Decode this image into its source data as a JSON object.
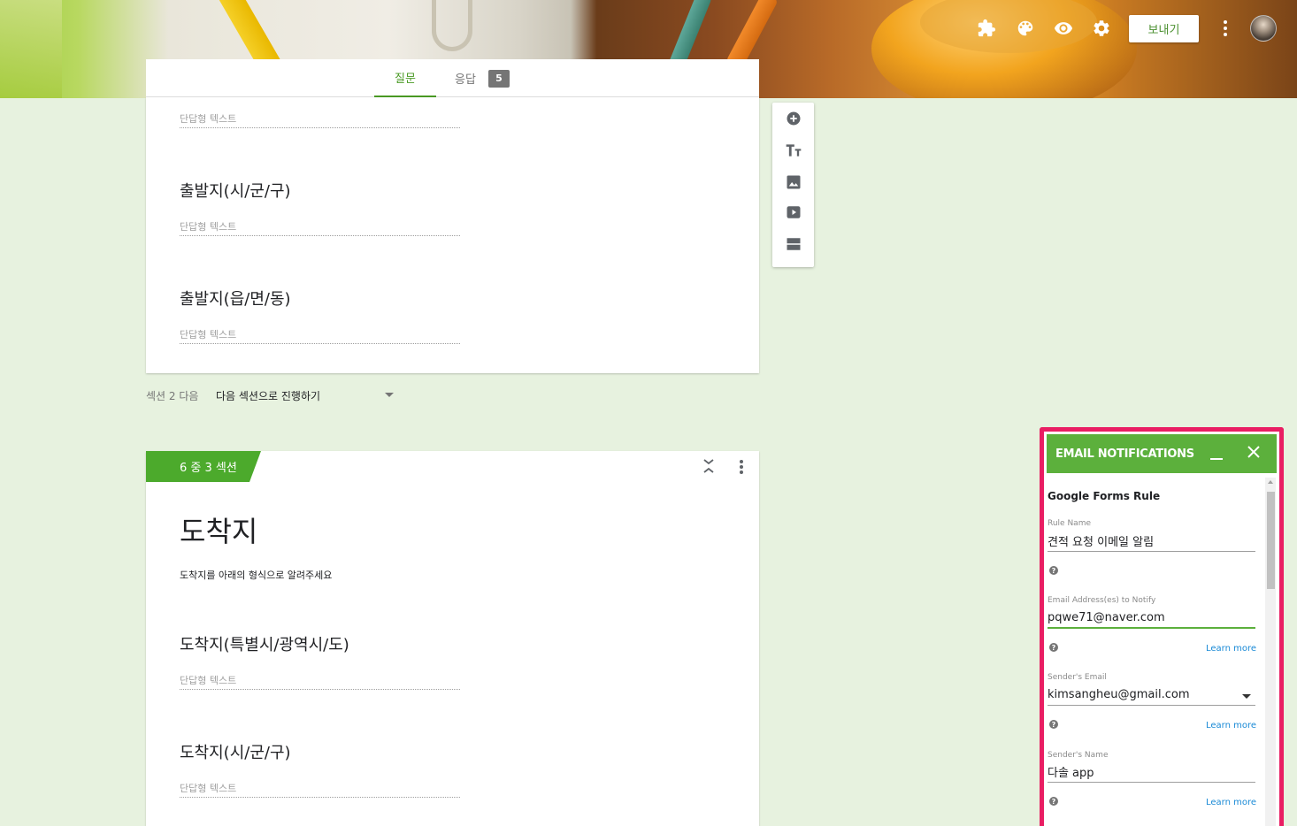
{
  "header": {
    "send_label": "보내기",
    "icons": [
      "puzzle-icon",
      "palette-icon",
      "eye-icon",
      "gear-icon",
      "more-vert-icon"
    ]
  },
  "tabs": {
    "questions": "질문",
    "responses": "응답",
    "responses_count": "5"
  },
  "section2": {
    "questions": [
      {
        "title": "",
        "placeholder": "단답형 텍스트"
      },
      {
        "title": "출발지(시/군/구)",
        "placeholder": "단답형 텍스트"
      },
      {
        "title": "출발지(읍/면/동)",
        "placeholder": "단답형 텍스트"
      }
    ],
    "after_label": "섹션 2 다음",
    "after_value": "다음 섹션으로 진행하기"
  },
  "section3": {
    "tag": "6 중 3 섹션",
    "title": "도착지",
    "description": "도착지를 아래의 형식으로 알려주세요",
    "questions": [
      {
        "title": "도착지(특별시/광역시/도)",
        "placeholder": "단답형 텍스트"
      },
      {
        "title": "도착지(시/군/구)",
        "placeholder": "단답형 텍스트"
      }
    ]
  },
  "email_panel": {
    "title": "EMAIL NOTIFICATIONS",
    "rule_heading": "Google Forms Rule",
    "rule_name_label": "Rule Name",
    "rule_name_value": "견적 요청 이메일 알림",
    "email_label": "Email Address(es) to Notify",
    "email_value": "pqwe71@naver.com",
    "sender_email_label": "Sender's Email",
    "sender_email_value": "kimsangheu@gmail.com",
    "sender_name_label": "Sender's Name",
    "sender_name_value": "다솔 app",
    "learn_more": "Learn more",
    "help_glyph": "?"
  },
  "colors": {
    "accent": "#4caa2c",
    "panel_border": "#e91e63",
    "background": "#e7f2df",
    "link": "#1a8ad6"
  }
}
